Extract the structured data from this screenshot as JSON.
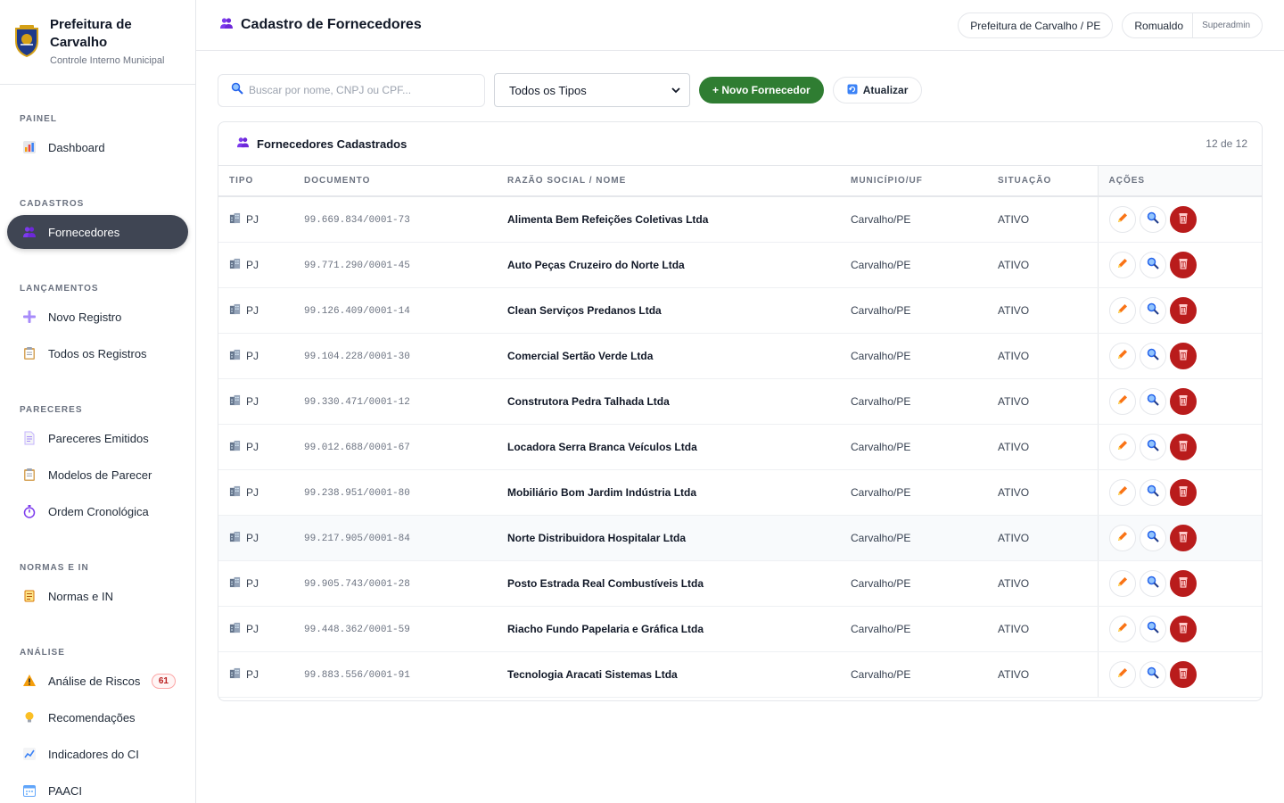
{
  "brand": {
    "title": "Prefeitura de Carvalho",
    "subtitle": "Controle Interno Municipal"
  },
  "sidebar": {
    "sections": [
      {
        "label": "PAINEL"
      },
      {
        "label": "CADASTROS"
      },
      {
        "label": "LANÇAMENTOS"
      },
      {
        "label": "PARECERES"
      },
      {
        "label": "NORMAS E IN"
      },
      {
        "label": "ANÁLISE"
      }
    ],
    "items": [
      {
        "label": "Dashboard",
        "icon": "bar-chart-icon"
      },
      {
        "label": "Fornecedores",
        "icon": "people-icon",
        "active": true
      },
      {
        "label": "Novo Registro",
        "icon": "plus-icon"
      },
      {
        "label": "Todos os Registros",
        "icon": "clipboard-icon"
      },
      {
        "label": "Pareceres Emitidos",
        "icon": "document-icon"
      },
      {
        "label": "Modelos de Parecer",
        "icon": "clipboard-icon"
      },
      {
        "label": "Ordem Cronológica",
        "icon": "stopwatch-icon"
      },
      {
        "label": "Normas e IN",
        "icon": "scroll-icon"
      },
      {
        "label": "Análise de Riscos",
        "icon": "warning-icon",
        "badge": "61"
      },
      {
        "label": "Recomendações",
        "icon": "lightbulb-icon"
      },
      {
        "label": "Indicadores do CI",
        "icon": "line-chart-icon"
      },
      {
        "label": "PAACI",
        "icon": "calendar-icon"
      }
    ]
  },
  "header": {
    "title": "Cadastro de Fornecedores",
    "entity": "Prefeitura de Carvalho / PE",
    "user": "Romualdo",
    "role": "Superadmin"
  },
  "toolbar": {
    "search_placeholder": "Buscar por nome, CNPJ ou CPF...",
    "filter_value": "Todos os Tipos",
    "new_label": "+ Novo Fornecedor",
    "refresh_label": "Atualizar"
  },
  "card": {
    "title": "Fornecedores Cadastrados",
    "count": "12 de 12"
  },
  "table": {
    "headers": [
      "TIPO",
      "DOCUMENTO",
      "RAZÃO SOCIAL / NOME",
      "MUNICÍPIO/UF",
      "SITUAÇÃO",
      "AÇÕES"
    ],
    "rows": [
      {
        "tipo": "PJ",
        "doc": "99.669.834/0001-73",
        "nome": "Alimenta Bem Refeições Coletivas Ltda",
        "mun": "Carvalho/PE",
        "sit": "ATIVO"
      },
      {
        "tipo": "PJ",
        "doc": "99.771.290/0001-45",
        "nome": "Auto Peças Cruzeiro do Norte Ltda",
        "mun": "Carvalho/PE",
        "sit": "ATIVO"
      },
      {
        "tipo": "PJ",
        "doc": "99.126.409/0001-14",
        "nome": "Clean Serviços Predanos Ltda",
        "mun": "Carvalho/PE",
        "sit": "ATIVO"
      },
      {
        "tipo": "PJ",
        "doc": "99.104.228/0001-30",
        "nome": "Comercial Sertão Verde Ltda",
        "mun": "Carvalho/PE",
        "sit": "ATIVO"
      },
      {
        "tipo": "PJ",
        "doc": "99.330.471/0001-12",
        "nome": "Construtora Pedra Talhada Ltda",
        "mun": "Carvalho/PE",
        "sit": "ATIVO"
      },
      {
        "tipo": "PJ",
        "doc": "99.012.688/0001-67",
        "nome": "Locadora Serra Branca Veículos Ltda",
        "mun": "Carvalho/PE",
        "sit": "ATIVO"
      },
      {
        "tipo": "PJ",
        "doc": "99.238.951/0001-80",
        "nome": "Mobiliário Bom Jardim Indústria Ltda",
        "mun": "Carvalho/PE",
        "sit": "ATIVO"
      },
      {
        "tipo": "PJ",
        "doc": "99.217.905/0001-84",
        "nome": "Norte Distribuidora Hospitalar Ltda",
        "mun": "Carvalho/PE",
        "sit": "ATIVO"
      },
      {
        "tipo": "PJ",
        "doc": "99.905.743/0001-28",
        "nome": "Posto Estrada Real Combustíveis Ltda",
        "mun": "Carvalho/PE",
        "sit": "ATIVO"
      },
      {
        "tipo": "PJ",
        "doc": "99.448.362/0001-59",
        "nome": "Riacho Fundo Papelaria e Gráfica Ltda",
        "mun": "Carvalho/PE",
        "sit": "ATIVO"
      },
      {
        "tipo": "PJ",
        "doc": "99.883.556/0001-91",
        "nome": "Tecnologia Aracati Sistemas Ltda",
        "mun": "Carvalho/PE",
        "sit": "ATIVO"
      }
    ]
  },
  "colors": {
    "accent_green": "#2f7d32",
    "danger_red": "#b91c1c",
    "active_nav": "#3f4553",
    "edit_orange": "#e8702a",
    "view_blue": "#1d6fd6"
  }
}
